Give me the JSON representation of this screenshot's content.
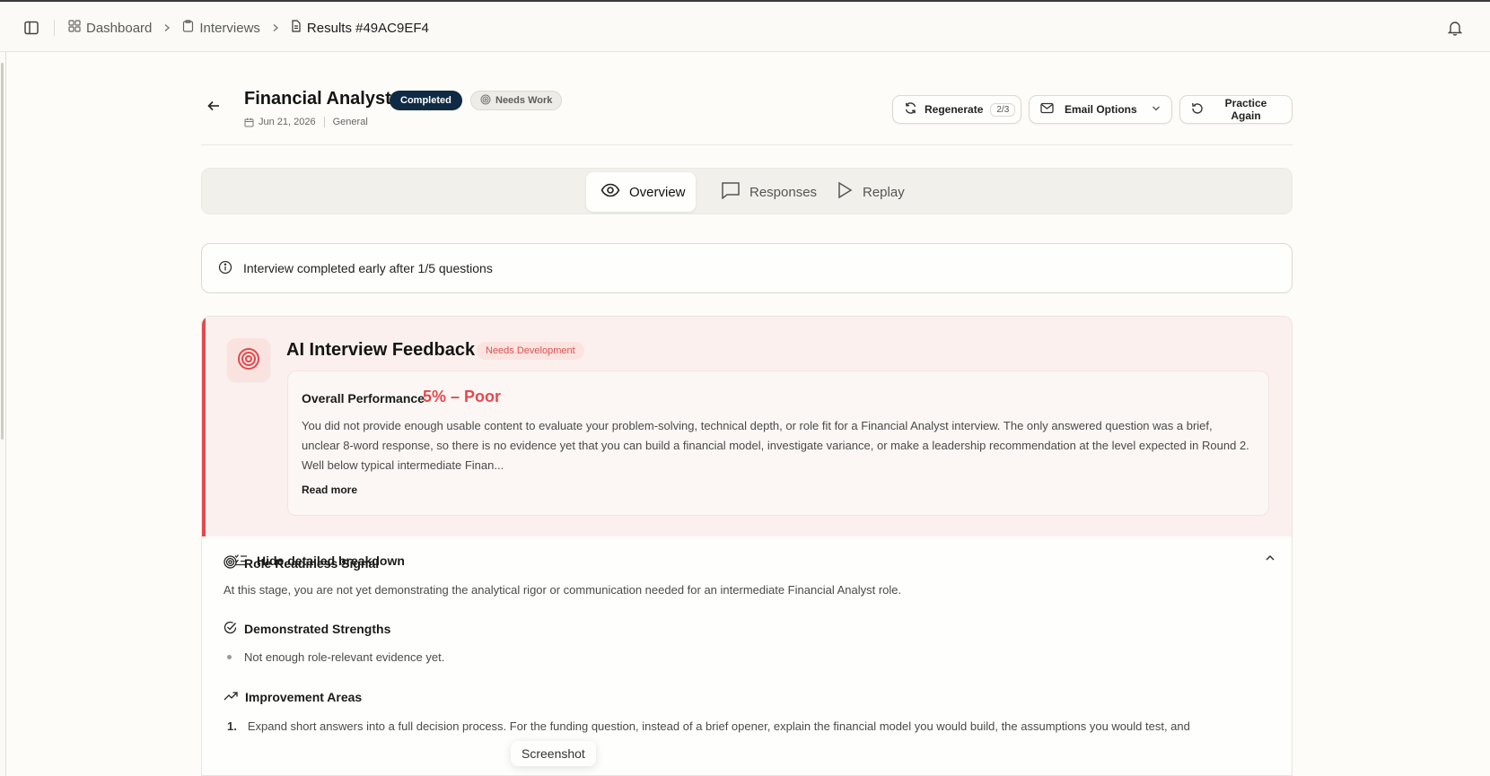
{
  "breadcrumb": {
    "dashboard": "Dashboard",
    "interviews": "Interviews",
    "current": "Results #49AC9EF4"
  },
  "header": {
    "title": "Financial Analyst",
    "status_badge": "Completed",
    "rating_badge": "Needs Work",
    "date": "Jun 21, 2026",
    "category": "General"
  },
  "actions": {
    "regenerate_label": "Regenerate",
    "regenerate_count": "2/3",
    "email_label": "Email Options",
    "practice_label": "Practice Again"
  },
  "tabs": [
    {
      "label": "Overview",
      "active": true
    },
    {
      "label": "Responses",
      "active": false
    },
    {
      "label": "Replay",
      "active": false
    }
  ],
  "info_notice": "Interview completed early after 1/5 questions",
  "feedback": {
    "title": "AI Interview Feedback",
    "level_badge": "Needs Development",
    "overall_label": "Overall Performance",
    "overall_score": "5% – Poor",
    "summary": "You did not provide enough usable content to evaluate your problem-solving, technical depth, or role fit for a Financial Analyst interview. The only answered question was a brief, unclear 8-word response, so there is no evidence yet that you can build a financial model, investigate variance, or make a leadership recommendation at the level expected in Round 2. Well below typical intermediate Finan...",
    "read_more": "Read more",
    "accent_color": "#e5484d"
  },
  "breakdown": {
    "toggle_label": "Hide detailed breakdown",
    "readiness_title": "Role Readiness Signal",
    "readiness_text": "At this stage, you are not yet demonstrating the analytical rigor or communication needed for an intermediate Financial Analyst role.",
    "strengths_title": "Demonstrated Strengths",
    "strengths": [
      "Not enough role-relevant evidence yet."
    ],
    "improvement_title": "Improvement Areas",
    "improvements": [
      {
        "num": "1.",
        "text": "Expand short answers into a full decision process. For the funding question, instead of a brief opener, explain the financial model you would build, the assumptions you would test, and"
      }
    ]
  },
  "toast": "Screenshot",
  "colors": {
    "brand_navy": "#0f2a44",
    "danger": "#e5484d",
    "background": "#fdfcf9"
  }
}
